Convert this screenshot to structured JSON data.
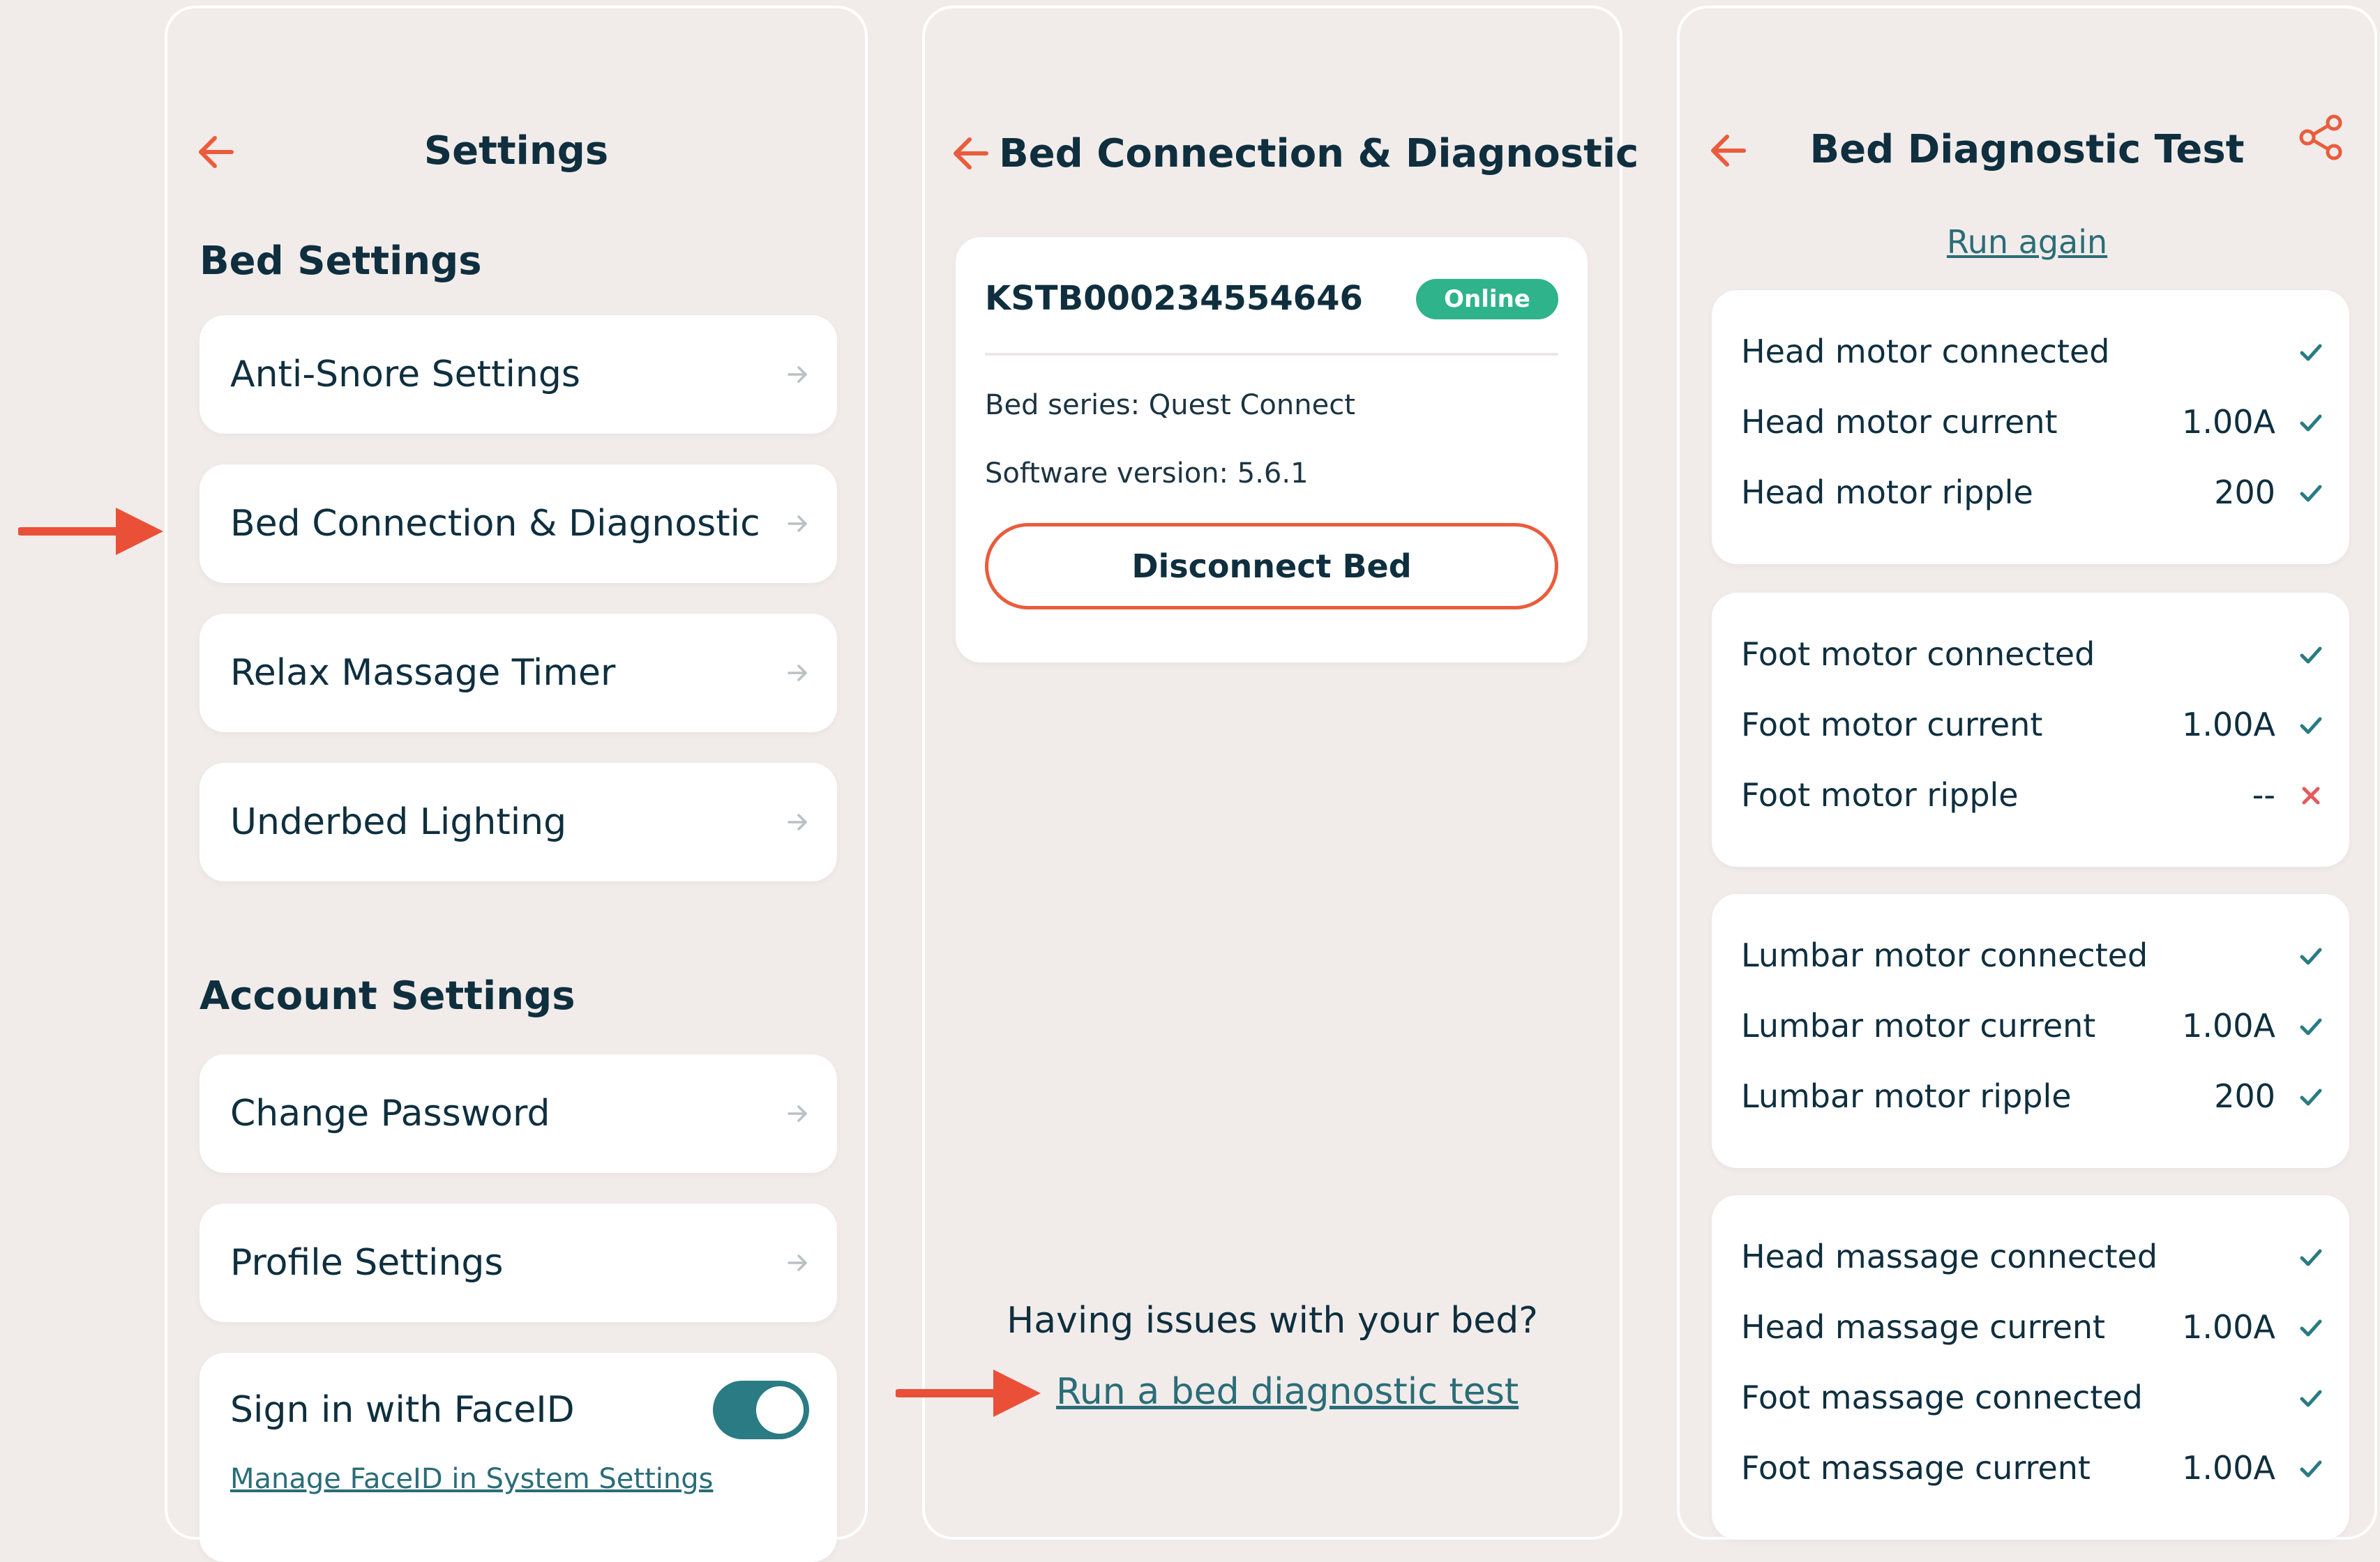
{
  "settings": {
    "title": "Settings",
    "bed_section": "Bed Settings",
    "bed_items": [
      {
        "label": "Anti-Snore Settings"
      },
      {
        "label": "Bed Connection & Diagnostic"
      },
      {
        "label": "Relax Massage Timer"
      },
      {
        "label": "Underbed Lighting"
      }
    ],
    "account_section": "Account Settings",
    "account_items": [
      {
        "label": "Change Password"
      },
      {
        "label": "Profile Settings"
      }
    ],
    "faceid": {
      "label": "Sign in with FaceID",
      "enabled": true,
      "link": "Manage FaceID in System Settings"
    }
  },
  "connection": {
    "title": "Bed Connection & Diagnostic",
    "serial": "KSTB000234554646",
    "status": "Online",
    "series": "Bed series: Quest Connect",
    "software": "Software version: 5.6.1",
    "disconnect_label": "Disconnect Bed",
    "issue_text": "Having issues with your bed?",
    "run_link": "Run a bed diagnostic test"
  },
  "diagnostic": {
    "title": "Bed Diagnostic Test",
    "run_again": "Run again",
    "groups": [
      {
        "rows": [
          {
            "label": "Head motor connected",
            "value": "",
            "ok": true
          },
          {
            "label": "Head motor current",
            "value": "1.00A",
            "ok": true
          },
          {
            "label": "Head motor ripple",
            "value": "200",
            "ok": true
          }
        ]
      },
      {
        "rows": [
          {
            "label": "Foot motor connected",
            "value": "",
            "ok": true
          },
          {
            "label": "Foot motor current",
            "value": "1.00A",
            "ok": true
          },
          {
            "label": "Foot motor ripple",
            "value": "--",
            "ok": false
          }
        ]
      },
      {
        "rows": [
          {
            "label": "Lumbar motor connected",
            "value": "",
            "ok": true
          },
          {
            "label": "Lumbar motor current",
            "value": "1.00A",
            "ok": true
          },
          {
            "label": "Lumbar motor ripple",
            "value": "200",
            "ok": true
          }
        ]
      },
      {
        "rows": [
          {
            "label": "Head massage connected",
            "value": "",
            "ok": true
          },
          {
            "label": "Head massage current",
            "value": "1.00A",
            "ok": true
          },
          {
            "label": "Foot massage connected",
            "value": "",
            "ok": true
          },
          {
            "label": "Foot massage current",
            "value": "1.00A",
            "ok": true
          }
        ]
      }
    ]
  },
  "colors": {
    "accent": "#ea5c3c",
    "teal": "#2a7b84",
    "online": "#2fb38a",
    "ink": "#0f2f3f",
    "fail": "#e45a5a"
  },
  "icons": {
    "back": "arrow-left-icon",
    "row": "arrow-right-icon",
    "share": "share-icon",
    "check": "check-icon",
    "fail": "x-icon"
  }
}
